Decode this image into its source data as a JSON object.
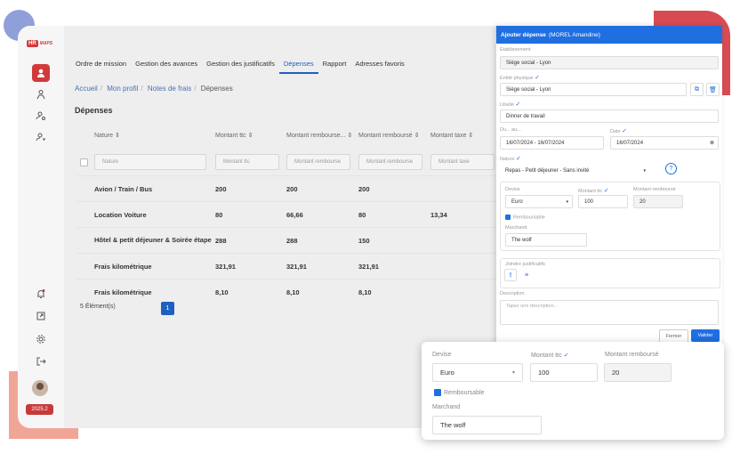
{
  "logo": {
    "box": "HR",
    "text": "MAPS"
  },
  "version": "2025.2",
  "tabs": [
    {
      "label": "Ordre de mission"
    },
    {
      "label": "Gestion des avances"
    },
    {
      "label": "Gestion des justificatifs"
    },
    {
      "label": "Dépenses"
    },
    {
      "label": "Rapport"
    },
    {
      "label": "Adresses favoris"
    }
  ],
  "breadcrumb": [
    "Accueil",
    "Mon profil",
    "Notes de frais",
    "Dépenses"
  ],
  "page_title": "Dépenses",
  "table": {
    "headers": [
      "Nature",
      "Montant ttc",
      "Montant rembourse...",
      "Montant remboursé",
      "Montant taxe"
    ],
    "filters": [
      "Nature",
      "Montant ttc",
      "Montant rembourse",
      "Montant rembourse",
      "Montant taxe"
    ],
    "rows": [
      [
        "Avion / Train / Bus",
        "200",
        "200",
        "200",
        ""
      ],
      [
        "Location Voiture",
        "80",
        "66,66",
        "80",
        "13,34"
      ],
      [
        "Hôtel & petit déjeuner & Soirée étape",
        "288",
        "288",
        "150",
        ""
      ],
      [
        "Frais kilométrique",
        "321,91",
        "321,91",
        "321,91",
        ""
      ],
      [
        "Frais kilométrique",
        "8,10",
        "8,10",
        "8,10",
        ""
      ]
    ]
  },
  "pager": {
    "count_label": "5 Élément(s)",
    "page": "1"
  },
  "drawer": {
    "title": "Ajouter dépense",
    "subtitle": "(MOREL Amandine)",
    "etablissement_label": "Établissement",
    "etablissement_value": "Siège social - Lyon",
    "entite_label": "Entité physique",
    "entite_value": "Siège social - Lyon",
    "libelle_label": "Libellé",
    "libelle_value": "Dinner de travail",
    "du_label": "Du... au...",
    "du_value": "16/07/2024 - 16/07/2024",
    "date_label": "Date",
    "date_value": "16/07/2024",
    "nature_label": "Nature",
    "nature_value": "Repas - Petit déjeuner - Sans invité",
    "devise_label": "Devise",
    "devise_value": "Euro",
    "montant_ttc_label": "Montant ttc",
    "montant_ttc_value": "100",
    "montant_rembourse_label": "Montant remboursé",
    "montant_rembourse_value": "20",
    "remboursable_label": "Remboursable",
    "marchand_label": "Marchand",
    "marchand_value": "The wolf",
    "justificatifs_label": "Joindre justificatifs",
    "description_label": "Description",
    "description_placeholder": "Tapez une description...",
    "cancel_label": "Fermer",
    "submit_label": "Valider"
  },
  "zoom": {
    "devise_label": "Devise",
    "devise_value": "Euro",
    "montant_ttc_label": "Montant ttc",
    "montant_ttc_value": "100",
    "montant_rembourse_label": "Montant remboursé",
    "montant_rembourse_value": "20",
    "remboursable_label": "Remboursable",
    "marchand_label": "Marchand",
    "marchand_value": "The wolf"
  },
  "colors": {
    "accent": "#1f6fe0",
    "brand_red": "#d23a3a",
    "deco_red": "#d84b52",
    "deco_pink": "#f1a597",
    "deco_blue": "#8f9fd9"
  },
  "icons": [
    "user-icon",
    "org-icon",
    "user-settings-icon",
    "user-key-icon",
    "bell-icon",
    "export-icon",
    "settings-icon",
    "logout-icon",
    "copy-icon",
    "delete-icon",
    "calendar-icon",
    "help-icon",
    "upload-icon",
    "list-icon",
    "check-icon",
    "chevron-down-icon"
  ]
}
